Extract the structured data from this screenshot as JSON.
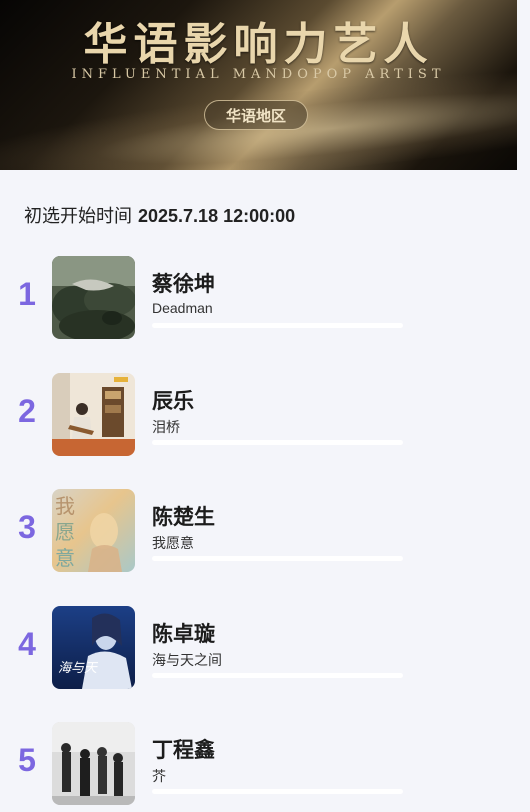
{
  "banner": {
    "title": "华语影响力艺人",
    "subtitle": "INFLUENTIAL MANDOPOP ARTIST",
    "region": "华语地区"
  },
  "start_time": {
    "label": "初选开始时间",
    "value": "2025.7.18 12:00:00"
  },
  "rankings": [
    {
      "rank": "1",
      "artist": "蔡徐坤",
      "song": "Deadman"
    },
    {
      "rank": "2",
      "artist": "辰乐",
      "song": "泪桥"
    },
    {
      "rank": "3",
      "artist": "陈楚生",
      "song": "我愿意",
      "cover_text": "我愿意"
    },
    {
      "rank": "4",
      "artist": "陈卓璇",
      "song": "海与天之间",
      "cover_text": "海与天"
    },
    {
      "rank": "5",
      "artist": "丁程鑫",
      "song": "芥"
    }
  ],
  "colors": {
    "rank_number": "#7c67e0",
    "banner_gold": "#e9d6ac",
    "page_background": "#f4f5fa"
  }
}
